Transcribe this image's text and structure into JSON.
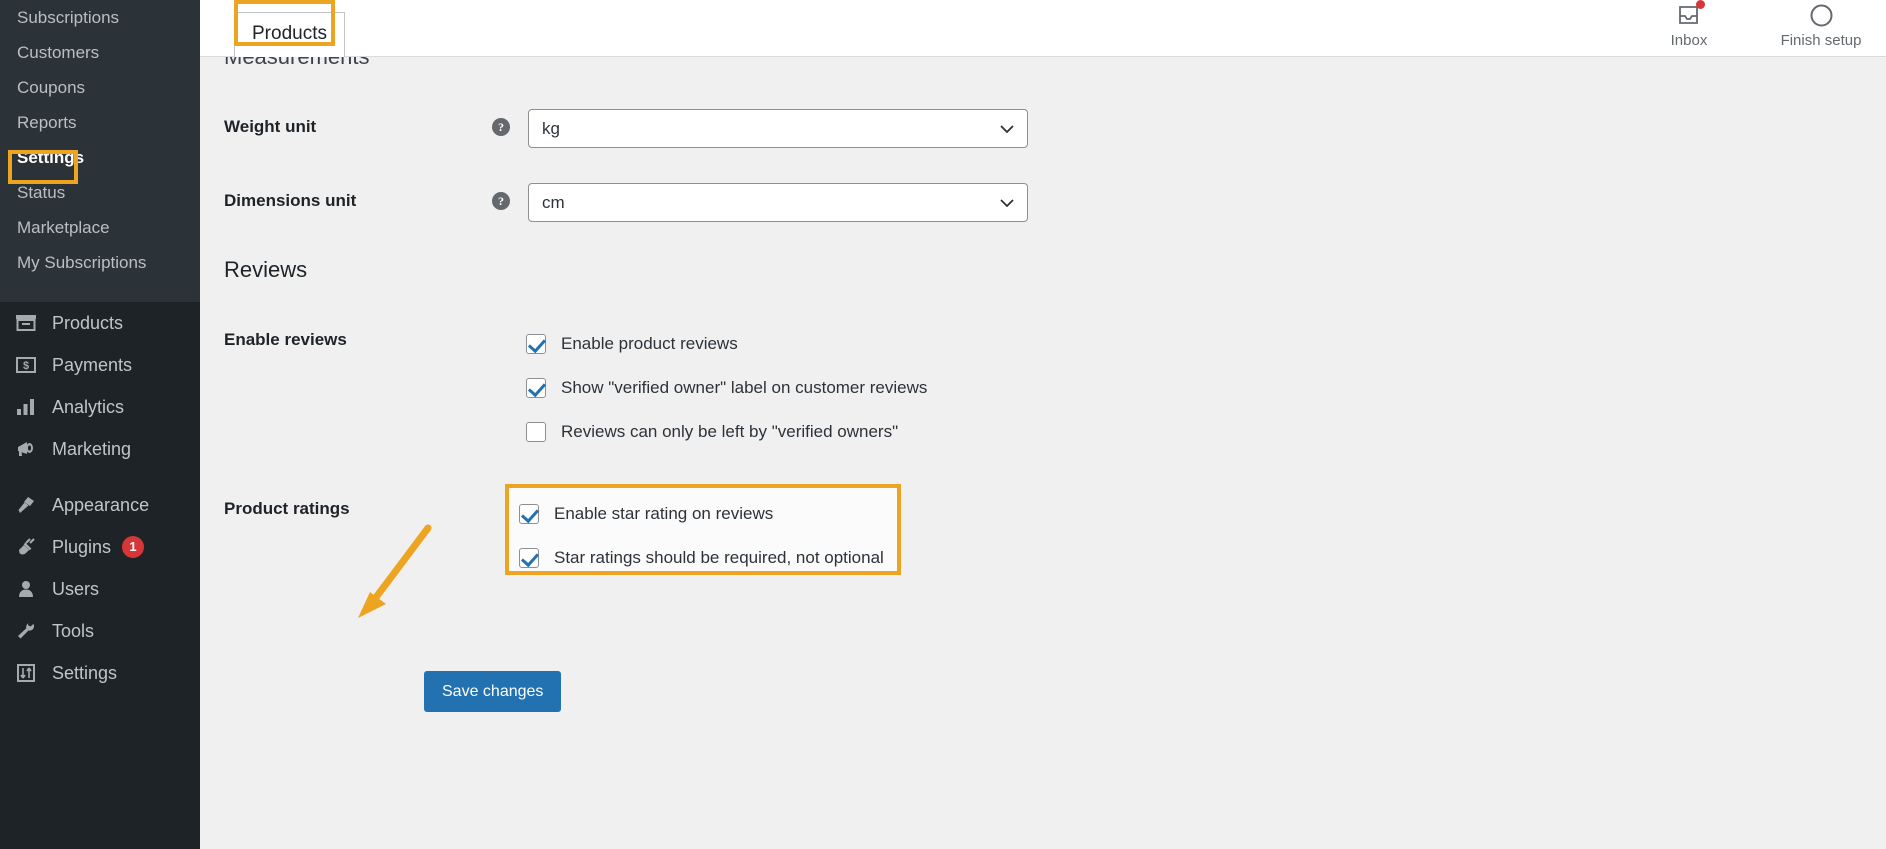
{
  "sidebar": {
    "submenu": [
      {
        "label": "Subscriptions",
        "current": false
      },
      {
        "label": "Customers",
        "current": false
      },
      {
        "label": "Coupons",
        "current": false
      },
      {
        "label": "Reports",
        "current": false
      },
      {
        "label": "Settings",
        "current": true
      },
      {
        "label": "Status",
        "current": false
      },
      {
        "label": "Marketplace",
        "current": false
      },
      {
        "label": "My Subscriptions",
        "current": false
      }
    ],
    "menu": [
      {
        "label": "Products",
        "icon": "products-icon",
        "badge": null
      },
      {
        "label": "Payments",
        "icon": "payments-icon",
        "badge": null
      },
      {
        "label": "Analytics",
        "icon": "analytics-icon",
        "badge": null
      },
      {
        "label": "Marketing",
        "icon": "marketing-icon",
        "badge": null
      },
      {
        "label": "Appearance",
        "icon": "appearance-icon",
        "badge": null
      },
      {
        "label": "Plugins",
        "icon": "plugins-icon",
        "badge": "1"
      },
      {
        "label": "Users",
        "icon": "users-icon",
        "badge": null
      },
      {
        "label": "Tools",
        "icon": "tools-icon",
        "badge": null
      },
      {
        "label": "Settings",
        "icon": "settings-icon",
        "badge": null
      }
    ]
  },
  "topbar": {
    "tabs": [
      {
        "label": "Products",
        "active": true
      }
    ],
    "actions": [
      {
        "label": "Inbox",
        "icon": "inbox-icon",
        "has_notification": true
      },
      {
        "label": "Finish setup",
        "icon": "progress-circle-icon",
        "has_notification": false
      }
    ]
  },
  "main": {
    "measurements_heading": "Measurements",
    "weight_unit": {
      "label": "Weight unit",
      "value": "kg",
      "help": "?"
    },
    "dimensions_unit": {
      "label": "Dimensions unit",
      "value": "cm",
      "help": "?"
    },
    "reviews_heading": "Reviews",
    "enable_reviews": {
      "label": "Enable reviews",
      "options": [
        {
          "label": "Enable product reviews",
          "checked": true
        },
        {
          "label": "Show \"verified owner\" label on customer reviews",
          "checked": true
        },
        {
          "label": "Reviews can only be left by \"verified owners\"",
          "checked": false
        }
      ]
    },
    "product_ratings": {
      "label": "Product ratings",
      "options": [
        {
          "label": "Enable star rating on reviews",
          "checked": true
        },
        {
          "label": "Star ratings should be required, not optional",
          "checked": true
        }
      ]
    },
    "save_label": "Save changes"
  },
  "colors": {
    "accent": "#2271b1",
    "annotation": "#eda521",
    "sidebar_bg": "#1d2327",
    "submenu_bg": "#2c3338",
    "badge": "#d63638"
  }
}
